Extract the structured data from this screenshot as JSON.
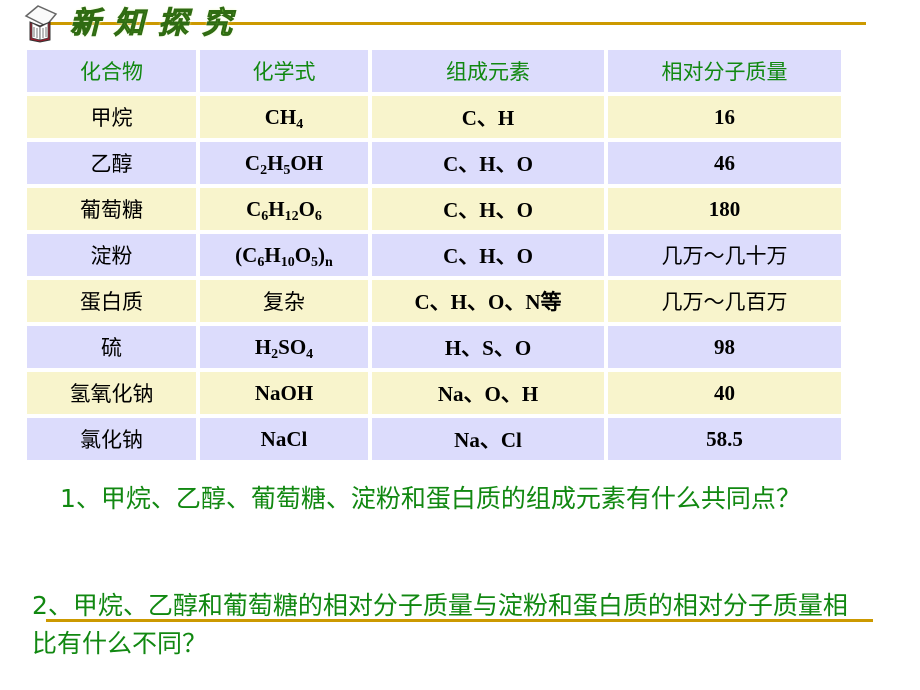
{
  "header": {
    "title_chars": [
      "新",
      "知",
      "探",
      "究"
    ],
    "logo_icon": "open-book-icon"
  },
  "colors": {
    "accent_line": "#cc9900",
    "header_bg": "#dcdcfc",
    "row_yellow": "#f8f4cc",
    "row_blue": "#dcdcfc",
    "green_text": "#118811"
  },
  "table": {
    "columns": [
      "化合物",
      "化学式",
      "组成元素",
      "相对分子质量"
    ],
    "rows": [
      {
        "compound": "甲烷",
        "formula": [
          [
            "CH",
            ""
          ],
          [
            "4",
            "sub"
          ]
        ],
        "formula_text": "CH4",
        "elements": "C、H",
        "mass": "16"
      },
      {
        "compound": "乙醇",
        "formula": [
          [
            "C",
            ""
          ],
          [
            "2",
            "sub"
          ],
          [
            "H",
            ""
          ],
          [
            "5",
            "sub"
          ],
          [
            "OH",
            ""
          ]
        ],
        "formula_text": "C2H5OH",
        "elements": "C、H、O",
        "mass": "46"
      },
      {
        "compound": "葡萄糖",
        "formula": [
          [
            "C",
            ""
          ],
          [
            "6",
            "sub"
          ],
          [
            "H",
            ""
          ],
          [
            "12",
            "sub"
          ],
          [
            "O",
            ""
          ],
          [
            "6",
            "sub"
          ]
        ],
        "formula_text": "C6H12O6",
        "elements": "C、H、O",
        "mass": "180"
      },
      {
        "compound": "淀粉",
        "formula": [
          [
            "(C",
            ""
          ],
          [
            "6",
            "sub"
          ],
          [
            "H",
            ""
          ],
          [
            "10",
            "sub"
          ],
          [
            "O",
            ""
          ],
          [
            "5",
            "sub"
          ],
          [
            ")",
            ""
          ],
          [
            "n",
            "sub"
          ]
        ],
        "formula_text": "(C6H10O5)n",
        "elements": "C、H、O",
        "mass": "几万～几十万"
      },
      {
        "compound": "蛋白质",
        "formula": [
          [
            "复杂",
            ""
          ]
        ],
        "formula_text": "复杂",
        "elements": "C、H、O、N等",
        "mass": "几万～几百万"
      },
      {
        "compound": "硫",
        "formula": [
          [
            "H",
            ""
          ],
          [
            "2",
            "sub"
          ],
          [
            "SO",
            ""
          ],
          [
            "4",
            "sub"
          ]
        ],
        "formula_text": "H2SO4",
        "elements": "H、S、O",
        "mass": "98"
      },
      {
        "compound": "氢氧化钠",
        "formula": [
          [
            "NaOH",
            ""
          ]
        ],
        "formula_text": "NaOH",
        "elements": "Na、O、H",
        "mass": "40"
      },
      {
        "compound": "氯化钠",
        "formula": [
          [
            "NaCl",
            ""
          ]
        ],
        "formula_text": "NaCl",
        "elements": "Na、Cl",
        "mass": "58.5"
      }
    ]
  },
  "questions": {
    "q1": "1、甲烷、乙醇、葡萄糖、淀粉和蛋白质的组成元素有什么共同点？",
    "q2": "2、甲烷、乙醇和葡萄糖的相对分子质量与淀粉和蛋白质的相对分子质量相比有什么不同？"
  }
}
